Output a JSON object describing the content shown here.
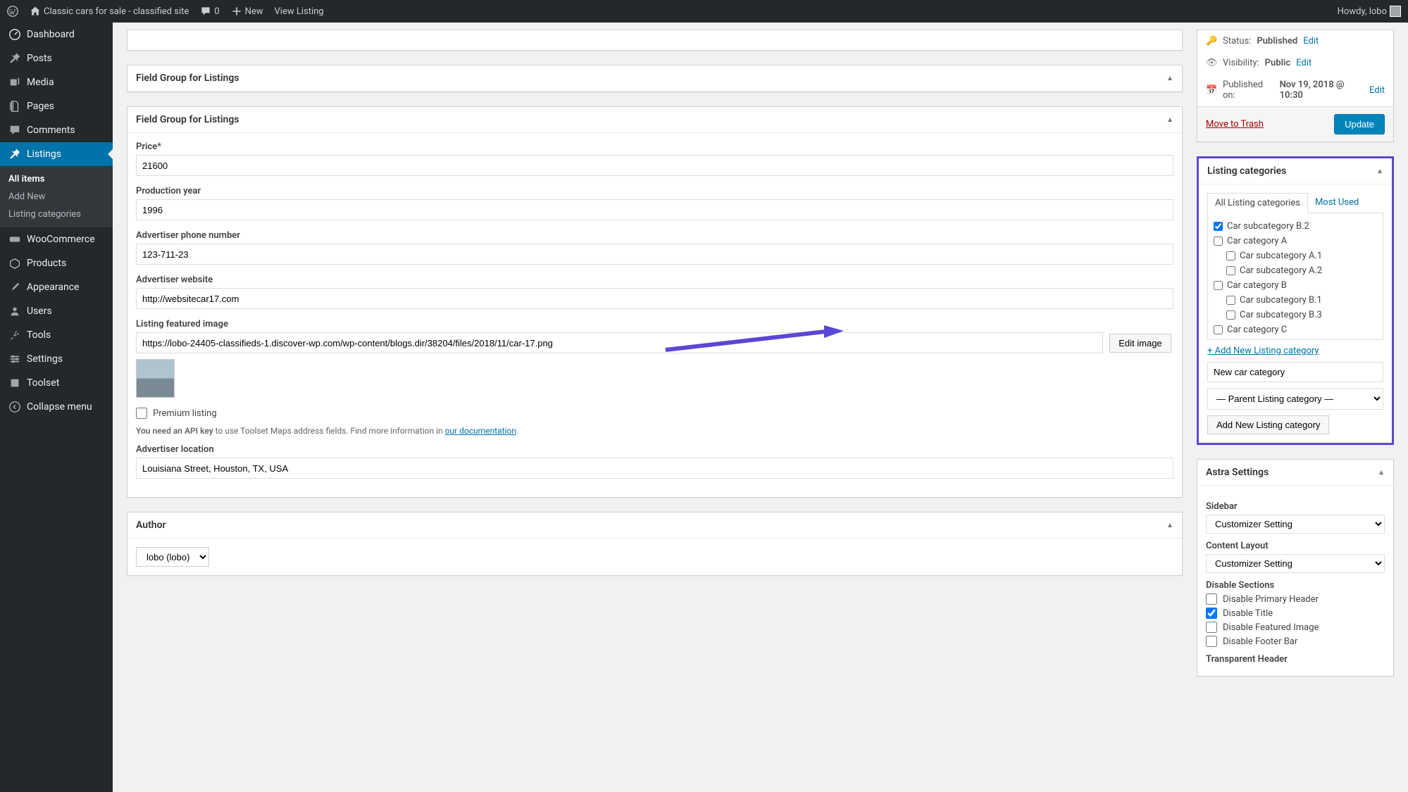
{
  "adminbar": {
    "site_name": "Classic cars for sale - classified site",
    "comments_count": "0",
    "new_label": "New",
    "view_listing_label": "View Listing",
    "howdy": "Howdy, lobo"
  },
  "sidebar": {
    "dashboard": "Dashboard",
    "posts": "Posts",
    "media": "Media",
    "pages": "Pages",
    "comments": "Comments",
    "listings": "Listings",
    "woocommerce": "WooCommerce",
    "products": "Products",
    "appearance": "Appearance",
    "users": "Users",
    "tools": "Tools",
    "settings": "Settings",
    "toolset": "Toolset",
    "collapse": "Collapse menu",
    "sub": {
      "all_items": "All items",
      "add_new": "Add New",
      "listing_categories": "Listing categories"
    }
  },
  "metabox1_title": "Field Group for Listings",
  "metabox2_title": "Field Group for Listings",
  "fields": {
    "price_label": "Price*",
    "price_value": "21600",
    "year_label": "Production year",
    "year_value": "1996",
    "phone_label": "Advertiser phone number",
    "phone_value": "123-711-23",
    "website_label": "Advertiser website",
    "website_value": "http://websitecar17.com",
    "featured_label": "Listing featured image",
    "featured_value": "https://lobo-24405-classifieds-1.discover-wp.com/wp-content/blogs.dir/38204/files/2018/11/car-17.png",
    "edit_image_btn": "Edit image",
    "premium_label": "Premium listing",
    "hint_prefix": "You need an API key",
    "hint_mid": " to use Toolset Maps address fields. Find more information in ",
    "hint_link": "our documentation",
    "location_label": "Advertiser location",
    "location_value": "Louisiana Street, Houston, TX, USA"
  },
  "author": {
    "box_title": "Author",
    "value": "lobo (lobo)"
  },
  "publish": {
    "status_label": "Status:",
    "status_value": "Published",
    "visibility_label": "Visibility:",
    "visibility_value": "Public",
    "published_label": "Published on:",
    "published_value": "Nov 19, 2018 @ 10:30",
    "edit_link": "Edit",
    "trash": "Move to Trash",
    "update_btn": "Update"
  },
  "categories": {
    "box_title": "Listing categories",
    "tab_all": "All Listing categories",
    "tab_most": "Most Used",
    "items": [
      {
        "label": "Car subcategory B.2",
        "checked": true,
        "indent": 0
      },
      {
        "label": "Car category A",
        "checked": false,
        "indent": 0
      },
      {
        "label": "Car subcategory A.1",
        "checked": false,
        "indent": 1
      },
      {
        "label": "Car subcategory A.2",
        "checked": false,
        "indent": 1
      },
      {
        "label": "Car category B",
        "checked": false,
        "indent": 0
      },
      {
        "label": "Car subcategory B.1",
        "checked": false,
        "indent": 1
      },
      {
        "label": "Car subcategory B.3",
        "checked": false,
        "indent": 1
      },
      {
        "label": "Car category C",
        "checked": false,
        "indent": 0
      }
    ],
    "add_link": "+ Add New Listing category",
    "new_cat_value": "New car category",
    "parent_select": "— Parent Listing category —",
    "add_btn": "Add New Listing category"
  },
  "astra": {
    "box_title": "Astra Settings",
    "sidebar_label": "Sidebar",
    "sidebar_value": "Customizer Setting",
    "content_label": "Content Layout",
    "content_value": "Customizer Setting",
    "disable_label": "Disable Sections",
    "disable_primary": "Disable Primary Header",
    "disable_title": "Disable Title",
    "disable_featured": "Disable Featured Image",
    "disable_footer": "Disable Footer Bar",
    "transparent_label": "Transparent Header"
  }
}
